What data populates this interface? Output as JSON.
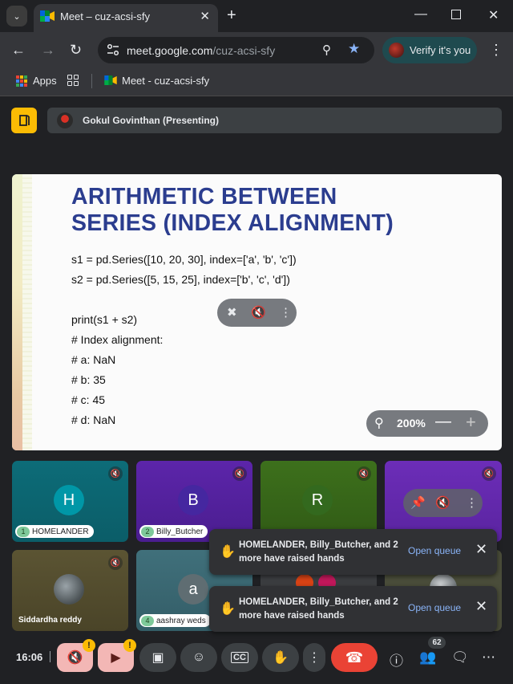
{
  "browser": {
    "tab_title": "Meet – cuz-acsi-sfy",
    "url_host": "meet.google.com",
    "url_path": "/cuz-acsi-sfy",
    "verify_label": "Verify it's you",
    "bookmarks": [
      {
        "label": "Apps"
      },
      {
        "label": "Meet - cuz-acsi-sfy"
      }
    ]
  },
  "meet": {
    "presenter_label": "Gokul Govinthan (Presenting)",
    "slide": {
      "title_line1": "ARITHMETIC BETWEEN",
      "title_line2": "SERIES (INDEX ALIGNMENT)",
      "code_lines": [
        "s1 = pd.Series([10, 20, 30], index=['a', 'b', 'c'])",
        "s2 = pd.Series([5, 15, 25], index=['b', 'c', 'd'])",
        "",
        "print(s1 + s2)",
        "# Index alignment:",
        "# a: NaN",
        "# b: 35",
        "# c: 45",
        "# d: NaN"
      ]
    },
    "zoom_level": "200%",
    "participants": [
      {
        "initial": "H",
        "hand_num": "1",
        "name": "HOMELANDER",
        "color": "#0f6f7c"
      },
      {
        "initial": "B",
        "hand_num": "2",
        "name": "Billy_Butcher",
        "color": "#5b24a8"
      },
      {
        "initial": "R",
        "hand_num": "",
        "name": "",
        "color": "#3c6e1b"
      },
      {
        "initial": "",
        "hand_num": "",
        "name": "",
        "color": "#6a2cb6"
      },
      {
        "initial": "",
        "hand_num": "",
        "name": "Siddardha reddy",
        "color": "#5a5332"
      },
      {
        "initial": "a",
        "hand_num": "4",
        "name": "aashray weds",
        "color": "#3f6d78"
      }
    ],
    "toasts": [
      {
        "message": "HOMELANDER, Billy_Butcher, and 2 more have raised hands",
        "action": "Open queue"
      },
      {
        "message": "HOMELANDER, Billy_Butcher, and 2 more have raised hands",
        "action": "Open queue"
      }
    ],
    "clock": "16:06",
    "people_count": "62",
    "colors": {
      "accent": "#8ab4f8",
      "hangup": "#ea4335",
      "companion": "#fbbc04"
    }
  }
}
